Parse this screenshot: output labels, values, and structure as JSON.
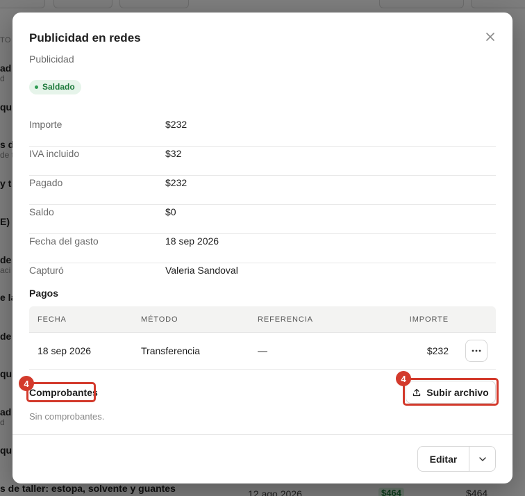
{
  "background": {
    "column_header_fragment": "TO",
    "row_fragments": [
      {
        "title": "ad",
        "sub": "d"
      },
      {
        "title": "qu",
        "sub": ""
      },
      {
        "title": "s de",
        "sub": "de t"
      },
      {
        "title": "y t",
        "sub": ""
      },
      {
        "title": "E)",
        "sub": ""
      },
      {
        "title": "de u",
        "sub": "aci"
      },
      {
        "title": "e la",
        "sub": ""
      },
      {
        "title": "de",
        "sub": ""
      },
      {
        "title": "qu",
        "sub": ""
      },
      {
        "title": "ad",
        "sub": "d"
      },
      {
        "title": "qu",
        "sub": ""
      }
    ],
    "bottom_row": {
      "title": "s de taller: estopa, solvente y guantes",
      "date": "12 ago 2026",
      "paid": "$464",
      "amount": "$464"
    }
  },
  "modal": {
    "title": "Publicidad en redes",
    "subtitle": "Publicidad",
    "status_badge": "Saldado",
    "close_icon": "close-icon",
    "details": [
      {
        "label": "Importe",
        "value": "$232"
      },
      {
        "label": "IVA incluido",
        "value": "$32"
      },
      {
        "label": "Pagado",
        "value": "$232"
      },
      {
        "label": "Saldo",
        "value": "$0"
      },
      {
        "label": "Fecha del gasto",
        "value": "18 sep 2026"
      },
      {
        "label": "Capturó",
        "value": "Valeria Sandoval"
      }
    ],
    "payments": {
      "title": "Pagos",
      "columns": [
        "FECHA",
        "MÉTODO",
        "REFERENCIA",
        "IMPORTE"
      ],
      "rows": [
        {
          "date": "18 sep 2026",
          "method": "Transferencia",
          "reference": "—",
          "amount": "$232",
          "actions_label": "···"
        }
      ]
    },
    "receipts": {
      "title": "Comprobantes",
      "empty_text": "Sin comprobantes.",
      "upload_label": "Subir archivo",
      "upload_icon": "upload-icon"
    },
    "footer": {
      "edit_label": "Editar",
      "caret_icon": "chevron-down-icon"
    },
    "annotations": [
      {
        "label": "4"
      },
      {
        "label": "4"
      }
    ],
    "colors": {
      "status_bg": "#e6f4ea",
      "status_text": "#1e7a3c",
      "highlight": "#d33a2c"
    }
  }
}
